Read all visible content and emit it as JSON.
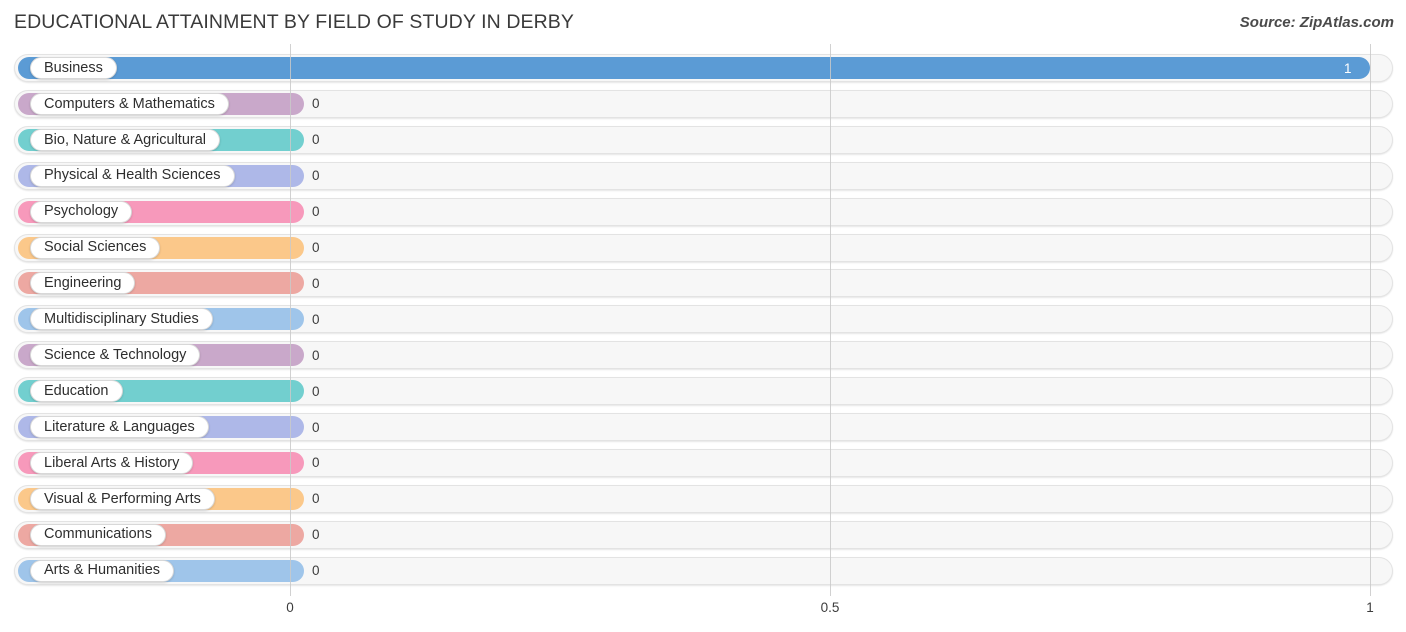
{
  "header": {
    "title": "EDUCATIONAL ATTAINMENT BY FIELD OF STUDY IN DERBY",
    "source": "Source: ZipAtlas.com"
  },
  "chart_data": {
    "type": "bar",
    "orientation": "horizontal",
    "title": "EDUCATIONAL ATTAINMENT BY FIELD OF STUDY IN DERBY",
    "xlabel": "",
    "ylabel": "",
    "xlim": [
      0,
      1
    ],
    "grid": true,
    "legend": "none",
    "axis_ticks": [
      "0",
      "0.5",
      "1"
    ],
    "axis_tick_values": [
      0,
      0.5,
      1
    ],
    "categories": [
      "Business",
      "Computers & Mathematics",
      "Bio, Nature & Agricultural",
      "Physical & Health Sciences",
      "Psychology",
      "Social Sciences",
      "Engineering",
      "Multidisciplinary Studies",
      "Science & Technology",
      "Education",
      "Literature & Languages",
      "Liberal Arts & History",
      "Visual & Performing Arts",
      "Communications",
      "Arts & Humanities"
    ],
    "values": [
      1,
      0,
      0,
      0,
      0,
      0,
      0,
      0,
      0,
      0,
      0,
      0,
      0,
      0,
      0
    ],
    "value_labels": [
      "1",
      "0",
      "0",
      "0",
      "0",
      "0",
      "0",
      "0",
      "0",
      "0",
      "0",
      "0",
      "0",
      "0",
      "0"
    ],
    "bar_colors": [
      "#5b9bd5",
      "#c9a8ca",
      "#72cfcf",
      "#aeb8e8",
      "#f799bb",
      "#fbc88a",
      "#eda8a2",
      "#9fc5ea",
      "#c9a8ca",
      "#72cfcf",
      "#aeb8e8",
      "#f799bb",
      "#fbc88a",
      "#eda8a2",
      "#9fc5ea"
    ]
  },
  "style": {
    "track_bg": "#f7f7f7",
    "track_border": "#e3e3e3",
    "gridline_color": "#c9c9c9",
    "text_color": "#3c3c3c",
    "title_color": "#3a3a3a"
  }
}
